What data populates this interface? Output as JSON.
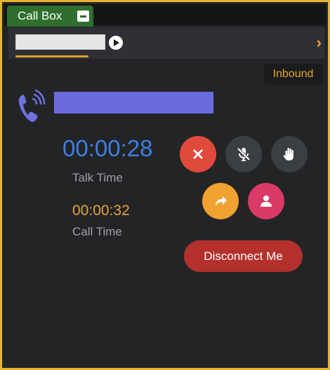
{
  "window": {
    "tab_title": "Call Box"
  },
  "call": {
    "direction": "Inbound",
    "talk_time": "00:00:28",
    "talk_time_label": "Talk Time",
    "call_time": "00:00:32",
    "call_time_label": "Call Time"
  },
  "actions": {
    "disconnect_label": "Disconnect Me",
    "icons": [
      "close-icon",
      "mic-off-icon",
      "hand-icon",
      "forward-icon",
      "user-icon"
    ]
  },
  "colors": {
    "accent_gold": "#e6b52c",
    "tab_green": "#2f6f2d",
    "talk_time_blue": "#3d7fe6",
    "call_time_orange": "#e8a33a",
    "end_red": "#e04a3c",
    "forward_orange": "#f0a230",
    "user_pink": "#d93a68",
    "disconnect_red": "#b3302d",
    "caller_bar_purple": "#6a6cde"
  }
}
